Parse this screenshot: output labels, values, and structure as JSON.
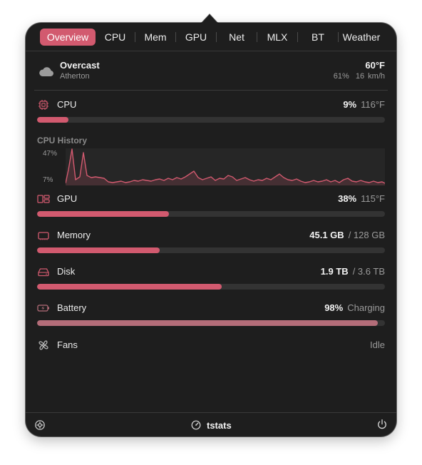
{
  "tabs": [
    "Overview",
    "CPU",
    "Mem",
    "GPU",
    "Net",
    "MLX",
    "BT",
    "Weather"
  ],
  "active_tab": "Overview",
  "weather": {
    "condition": "Overcast",
    "location": "Atherton",
    "temperature": "60°F",
    "humidity": "61%",
    "wind": "16 km/h",
    "icon": "cloud-icon"
  },
  "cpu": {
    "label": "CPU",
    "value": "9%",
    "secondary": "116°F",
    "fraction": 0.09,
    "icon": "cpu-chip-icon"
  },
  "cpu_history": {
    "title": "CPU History",
    "max_label": "47%",
    "min_label": "7%"
  },
  "gpu": {
    "label": "GPU",
    "value": "38%",
    "secondary": "115°F",
    "fraction": 0.38,
    "icon": "gpu-icon"
  },
  "memory": {
    "label": "Memory",
    "value": "45.1 GB",
    "secondary": "/ 128 GB",
    "fraction": 0.352,
    "icon": "memory-icon"
  },
  "disk": {
    "label": "Disk",
    "value": "1.9 TB",
    "secondary": "/ 3.6 TB",
    "fraction": 0.53,
    "icon": "disk-icon"
  },
  "battery": {
    "label": "Battery",
    "value": "98%",
    "secondary": "Charging",
    "fraction": 0.98,
    "icon": "battery-charging-icon"
  },
  "fans": {
    "label": "Fans",
    "status": "Idle",
    "icon": "fan-icon"
  },
  "footer": {
    "brand": "tstats",
    "left_icon": "settings-icon",
    "brand_icon": "gauge-icon",
    "right_icon": "power-icon"
  },
  "colors": {
    "accent": "#d25a6f",
    "track": "#333333",
    "panel": "#1e1e1e",
    "battery_fill": "#b46d79"
  }
}
